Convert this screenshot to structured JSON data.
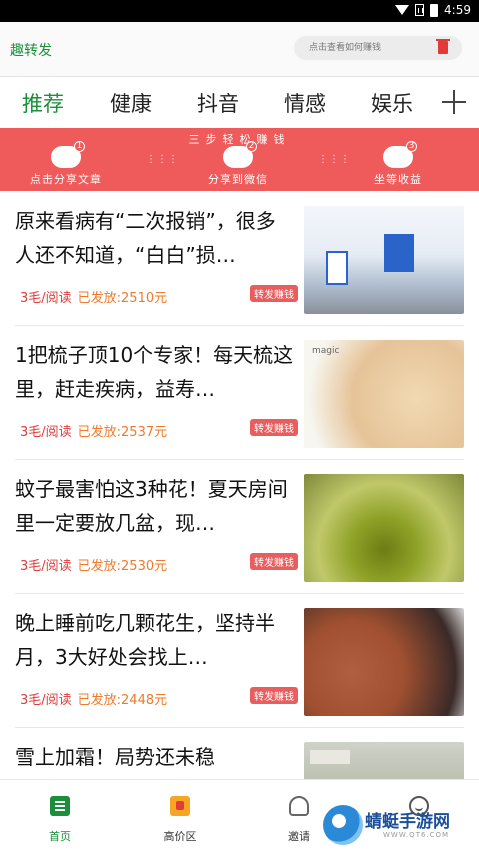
{
  "status_bar": {
    "time": "4:59"
  },
  "header": {
    "brand": "趣转发",
    "search_placeholder": "点击查看如何赚钱"
  },
  "tabs": [
    "推荐",
    "健康",
    "抖音",
    "情感",
    "娱乐"
  ],
  "banner": {
    "title": "三步轻松赚钱",
    "steps": [
      {
        "num": "1",
        "label": "点击分享文章"
      },
      {
        "num": "2",
        "label": "分享到微信"
      },
      {
        "num": "3",
        "label": "坐等收益"
      }
    ]
  },
  "feed": [
    {
      "title": "原来看病有“二次报销”，很多人还不知道，“白白”损…",
      "price": "3毛/阅读",
      "sent": "已发放:2510元",
      "tag": "转发赚钱"
    },
    {
      "title": "1把梳子顶10个专家！每天梳这里，赶走疾病，益寿…",
      "price": "3毛/阅读",
      "sent": "已发放:2537元",
      "tag": "转发赚钱"
    },
    {
      "title": "蚊子最害怕这3种花！夏天房间里一定要放几盆，现…",
      "price": "3毛/阅读",
      "sent": "已发放:2530元",
      "tag": "转发赚钱"
    },
    {
      "title": "晚上睡前吃几颗花生，坚持半月，3大好处会找上…",
      "price": "3毛/阅读",
      "sent": "已发放:2448元",
      "tag": "转发赚钱"
    },
    {
      "title": "雪上加霜！局势还未稳",
      "price": "",
      "sent": "",
      "tag": ""
    }
  ],
  "bottom_nav": [
    {
      "label": "首页",
      "icon": "home-icon"
    },
    {
      "label": "高价区",
      "icon": "gift-icon"
    },
    {
      "label": "邀请",
      "icon": "user-icon"
    },
    {
      "label": "",
      "icon": "smile-icon"
    }
  ],
  "watermark": {
    "text": "蜻蜓手游网",
    "sub": "WWW.QT6.COM"
  },
  "colors": {
    "accent": "#1b8e3a",
    "banner": "#ef5a5a",
    "price": "#e03c3c",
    "sent": "#f07a2a"
  }
}
